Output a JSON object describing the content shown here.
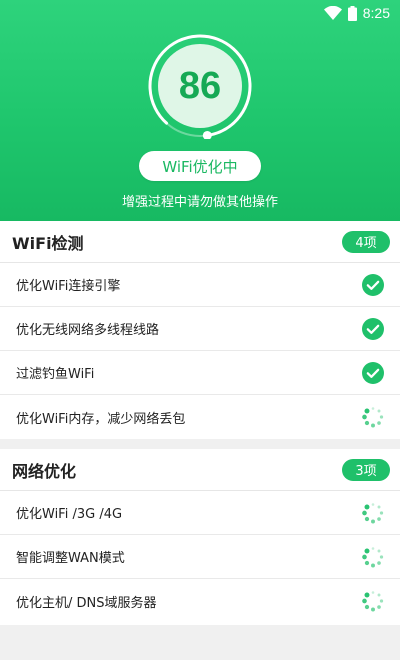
{
  "status_bar": {
    "time": "8:25",
    "wifi_icon": "wifi-signal-icon"
  },
  "header": {
    "score": "86",
    "status_label": "WiFi优化中",
    "subtitle": "增强过程中请勿做其他操作",
    "progress_fraction": 0.86
  },
  "colors": {
    "accent": "#1fc06a",
    "header_top": "#2ed37c",
    "header_bottom": "#17b962"
  },
  "sections": [
    {
      "title": "WiFi检测",
      "count": "4项",
      "items": [
        {
          "label": "优化WiFi连接引擎",
          "state": "done",
          "icon": "check-circle-icon"
        },
        {
          "label": "优化无线网络多线程线路",
          "state": "done",
          "icon": "check-circle-icon"
        },
        {
          "label": "过滤钓鱼WiFi",
          "state": "done",
          "icon": "check-circle-icon"
        },
        {
          "label": "优化WiFi内存，减少网络丢包",
          "state": "loading",
          "icon": "loading-spinner-icon"
        }
      ]
    },
    {
      "title": "网络优化",
      "count": "3项",
      "items": [
        {
          "label": "优化WiFi /3G /4G",
          "state": "loading",
          "icon": "loading-spinner-icon"
        },
        {
          "label": "智能调整WAN模式",
          "state": "loading",
          "icon": "loading-spinner-icon"
        },
        {
          "label": "优化主机/ DNS域服务器",
          "state": "loading",
          "icon": "loading-spinner-icon"
        }
      ]
    }
  ]
}
